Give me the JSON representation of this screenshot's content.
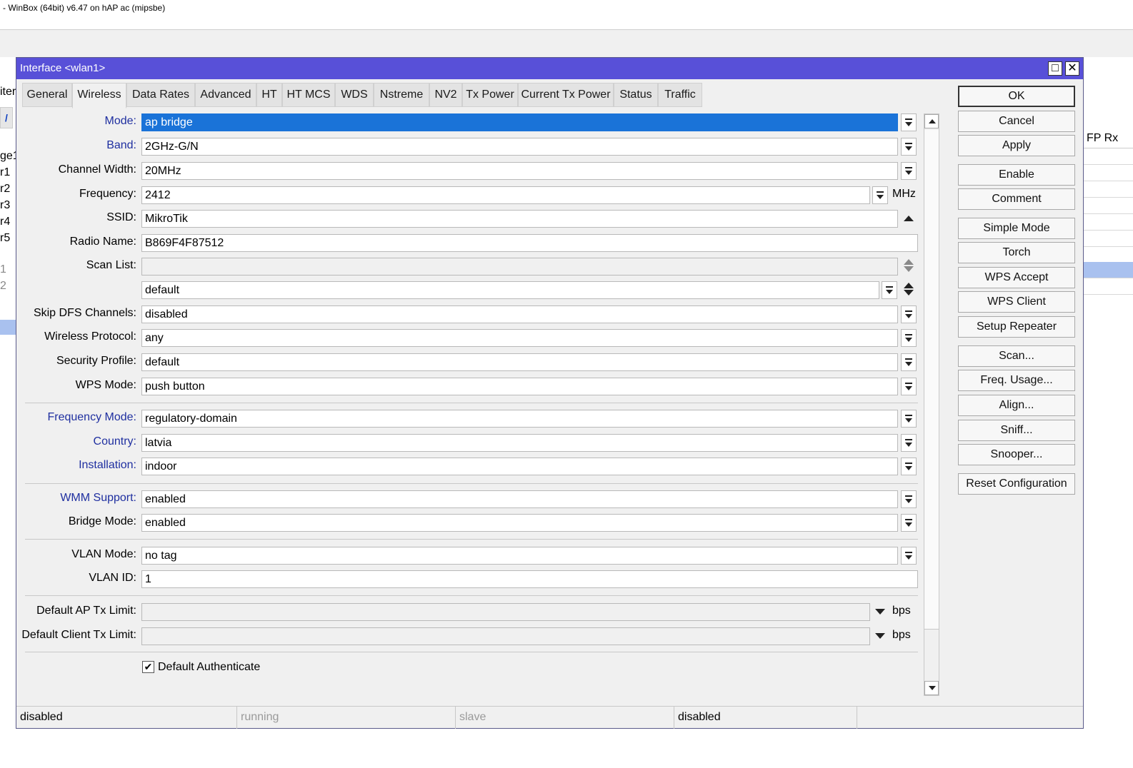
{
  "window": {
    "title": "- WinBox (64bit) v6.47 on hAP ac (mipsbe)"
  },
  "background": {
    "left_labels": [
      "iter",
      "ge1",
      "r1",
      "r2",
      "r3",
      "r4",
      "r5",
      "1",
      "2"
    ],
    "right_header": "FP Rx"
  },
  "dialog": {
    "title": "Interface <wlan1>",
    "maximize_glyph": "□",
    "close_glyph": "✕",
    "tabs": [
      "General",
      "Wireless",
      "Data Rates",
      "Advanced",
      "HT",
      "HT MCS",
      "WDS",
      "Nstreme",
      "NV2",
      "Tx Power",
      "Current Tx Power",
      "Status",
      "Traffic"
    ],
    "active_tab": "Wireless",
    "fields": {
      "mode": {
        "label": "Mode:",
        "value": "ap bridge"
      },
      "band": {
        "label": "Band:",
        "value": "2GHz-G/N"
      },
      "channel_width": {
        "label": "Channel Width:",
        "value": "20MHz"
      },
      "frequency": {
        "label": "Frequency:",
        "value": "2412",
        "unit": "MHz"
      },
      "ssid": {
        "label": "SSID:",
        "value": "MikroTik"
      },
      "radio_name": {
        "label": "Radio Name:",
        "value": "B869F4F87512"
      },
      "scan_list": {
        "label": "Scan List:",
        "value": "",
        "value2": "default"
      },
      "skip_dfs": {
        "label": "Skip DFS Channels:",
        "value": "disabled"
      },
      "wireless_protocol": {
        "label": "Wireless Protocol:",
        "value": "any"
      },
      "security_profile": {
        "label": "Security Profile:",
        "value": "default"
      },
      "wps_mode": {
        "label": "WPS Mode:",
        "value": "push button"
      },
      "frequency_mode": {
        "label": "Frequency Mode:",
        "value": "regulatory-domain"
      },
      "country": {
        "label": "Country:",
        "value": "latvia"
      },
      "installation": {
        "label": "Installation:",
        "value": "indoor"
      },
      "wmm_support": {
        "label": "WMM Support:",
        "value": "enabled"
      },
      "bridge_mode": {
        "label": "Bridge Mode:",
        "value": "enabled"
      },
      "vlan_mode": {
        "label": "VLAN Mode:",
        "value": "no tag"
      },
      "vlan_id": {
        "label": "VLAN ID:",
        "value": "1"
      },
      "ap_tx_limit": {
        "label": "Default AP Tx Limit:",
        "value": "",
        "unit": "bps"
      },
      "client_tx_limit": {
        "label": "Default Client Tx Limit:",
        "value": "",
        "unit": "bps"
      }
    },
    "default_authenticate": {
      "label": "Default Authenticate",
      "checked": true,
      "glyph": "✔"
    },
    "buttons": [
      "OK",
      "Cancel",
      "Apply",
      "Enable",
      "Comment",
      "Simple Mode",
      "Torch",
      "WPS Accept",
      "WPS Client",
      "Setup Repeater",
      "Scan...",
      "Freq. Usage...",
      "Align...",
      "Sniff...",
      "Snooper...",
      "Reset Configuration"
    ],
    "status": [
      "disabled",
      "running",
      "slave",
      "disabled",
      ""
    ],
    "colors": {
      "title_bg": "#5850d8",
      "highlight": "#1a73d8",
      "blue_label": "#1f2fa0"
    }
  }
}
